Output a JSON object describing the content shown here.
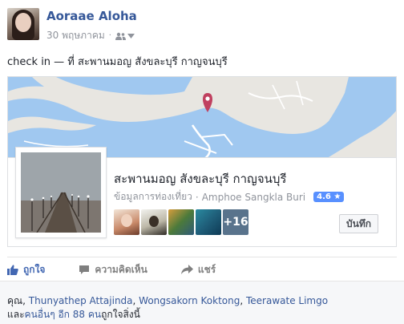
{
  "post": {
    "author": "Aoraae Aloha",
    "date": "30 พฤษภาคม",
    "text": "check in — ที่ สะพานมอญ สังขละบุรี กาญจนบุรี"
  },
  "place": {
    "name": "สะพานมอญ สังขละบุรี กาญจนบุรี",
    "category": "ข้อมูลการท่องเที่ยว",
    "location": "Amphoe Sangkla Buri",
    "rating": "4.6 ★",
    "more_count": "+16",
    "save_label": "บันทึก"
  },
  "actions": {
    "like": "ถูกใจ",
    "comment": "ความคิดเห็น",
    "share": "แชร์"
  },
  "likes": {
    "prefix": "คุณ, ",
    "name1": "Thunyathep Attajinda",
    "name2": "Wongsakorn Koktong",
    "name3": "Teerawate Limgo",
    "sep": ", ",
    "line2_prefix": "และ",
    "others_link": "คนอื่นๆ อีก 88 คน",
    "line2_suffix": "ถูกใจสิ่งนี้"
  },
  "colors": {
    "link": "#365899",
    "accent": "#4267b2",
    "rating_bg": "#5890ff",
    "map_water": "#a0c8f0",
    "map_land": "#e8e6e1",
    "pin": "#c0405f"
  },
  "icons": {
    "audience": "friends-icon",
    "dropdown": "chevron-down-icon",
    "like": "thumbs-up-icon",
    "comment": "comment-bubble-icon",
    "share": "share-arrow-icon",
    "pin": "map-pin-icon"
  }
}
